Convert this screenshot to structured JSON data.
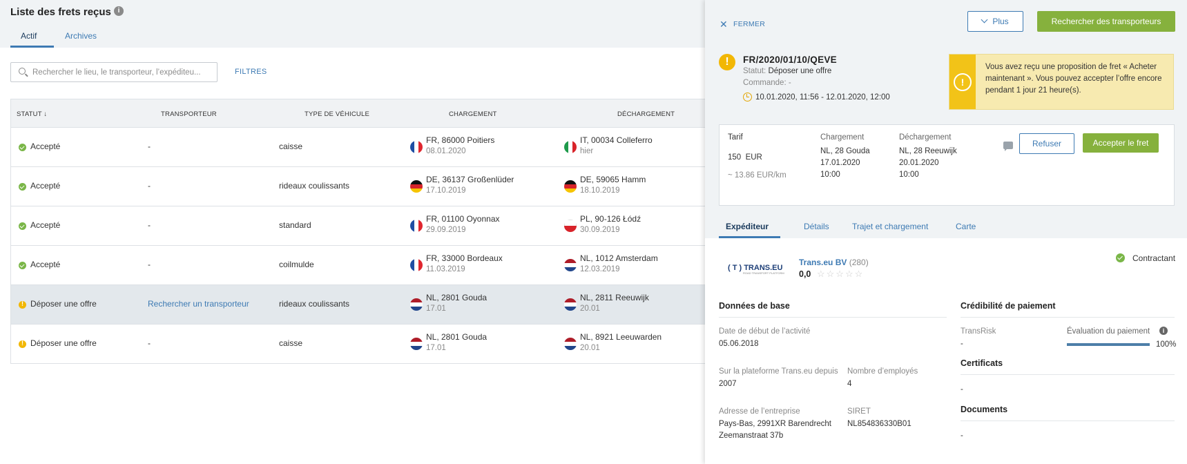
{
  "page": {
    "title": "Liste des frets reçus",
    "tabs": [
      "Actif",
      "Archives"
    ],
    "search_placeholder": "Rechercher le lieu, le transporteur, l’expéditeu...",
    "filters_label": "FILTRES"
  },
  "table": {
    "headers": [
      "STATUT ↓",
      "TRANSPORTEUR",
      "TYPE DE VÉHICULE",
      "CHARGEMENT",
      "DÉCHARGEMENT"
    ],
    "rows": [
      {
        "status": "Accepté",
        "status_type": "ok",
        "carrier": "-",
        "vehicle": "caisse",
        "load_flag": "fr",
        "load": "FR, 86000 Poitiers",
        "load_date": "08.01.2020",
        "unload_flag": "it",
        "unload": "IT, 00034 Colleferro",
        "unload_date": "hier"
      },
      {
        "status": "Accepté",
        "status_type": "ok",
        "carrier": "-",
        "vehicle": "rideaux coulissants",
        "load_flag": "de",
        "load": "DE, 36137 Großenlüder",
        "load_date": "17.10.2019",
        "unload_flag": "de",
        "unload": "DE, 59065 Hamm",
        "unload_date": "18.10.2019"
      },
      {
        "status": "Accepté",
        "status_type": "ok",
        "carrier": "-",
        "vehicle": "standard",
        "load_flag": "fr",
        "load": "FR, 01100 Oyonnax",
        "load_date": "29.09.2019",
        "unload_flag": "pl",
        "unload": "PL, 90-126 Łódź",
        "unload_date": "30.09.2019"
      },
      {
        "status": "Accepté",
        "status_type": "ok",
        "carrier": "-",
        "vehicle": "coilmulde",
        "load_flag": "fr",
        "load": "FR, 33000 Bordeaux",
        "load_date": "11.03.2019",
        "unload_flag": "nl",
        "unload": "NL, 1012 Amsterdam",
        "unload_date": "12.03.2019"
      },
      {
        "status": "Déposer une offre",
        "status_type": "warn",
        "carrier": "Rechercher un transporteur",
        "carrier_link": true,
        "vehicle": "rideaux coulissants",
        "load_flag": "nl",
        "load": "NL, 2801 Gouda",
        "load_date": "17.01",
        "unload_flag": "nl",
        "unload": "NL, 2811 Reeuwijk",
        "unload_date": "20.01",
        "selected": true
      },
      {
        "status": "Déposer une offre",
        "status_type": "warn",
        "carrier": "-",
        "vehicle": "caisse",
        "load_flag": "nl",
        "load": "NL, 2801 Gouda",
        "load_date": "17.01",
        "unload_flag": "nl",
        "unload": "NL, 8921 Leeuwarden",
        "unload_date": "20.01"
      }
    ]
  },
  "panel": {
    "close_label": "FERMER",
    "more_label": "Plus",
    "search_carriers_label": "Rechercher des transporteurs",
    "reference": "FR/2020/01/10/QEVE",
    "status_label": "Statut:",
    "status_value": "Déposer une offre",
    "order_label": "Commande:",
    "order_value": "-",
    "time_range": "10.01.2020, 11:56 - 12.01.2020, 12:00",
    "banner_text": "Vous avez reçu une proposition de fret « Acheter maintenant ». Vous pouvez accepter l’offre encore pendant 1 jour 21 heure(s).",
    "offer": {
      "tarif_label": "Tarif",
      "tarif_value": "150",
      "tarif_currency": "EUR",
      "per_km": "~ 13.86  EUR/km",
      "load_label": "Chargement",
      "load_lines": [
        "NL, 28 Gouda",
        "17.01.2020",
        "10:00"
      ],
      "unload_label": "Déchargement",
      "unload_lines": [
        "NL, 28 Reeuwijk",
        "20.01.2020",
        "10:00"
      ],
      "refuse_label": "Refuser",
      "accept_label": "Accepter le fret"
    },
    "detail_tabs": [
      "Expéditeur",
      "Détails",
      "Trajet et chargement",
      "Carte"
    ],
    "shipper": {
      "logo_text": "( T ) TRANS.EU",
      "logo_sub": "ROAD TRANSPORT PLATFORM",
      "name": "Trans.eu BV",
      "count": "(280)",
      "rating": "0,0",
      "stars": "☆☆☆☆☆",
      "contract_label": "Contractant"
    },
    "basic": {
      "title": "Données de base",
      "start_label": "Date de début de l’activité",
      "start_value": "05.06.2018",
      "platform_label": "Sur la plateforme Trans.eu depuis",
      "platform_value": "2007",
      "employees_label": "Nombre d’employés",
      "employees_value": "4",
      "address_label": "Adresse de l’entreprise",
      "address_line1": "Pays-Bas, 2991XR Barendrecht",
      "address_line2": "Zeemanstraat 37b",
      "siret_label": "SIRET",
      "siret_value": "NL854836330B01"
    },
    "credit": {
      "title": "Crédibilité de paiement",
      "transrisk_label": "TransRisk",
      "transrisk_value": "-",
      "eval_label": "Évaluation du paiement",
      "eval_value": "100%",
      "eval_fraction": 1.0,
      "cert_title": "Certificats",
      "cert_value": "-",
      "docs_title": "Documents",
      "docs_value": "-"
    }
  },
  "colors": {
    "accent": "#3d7ab3",
    "green": "#86b13d",
    "warning": "#f2b705",
    "banner": "#f7eab0"
  }
}
